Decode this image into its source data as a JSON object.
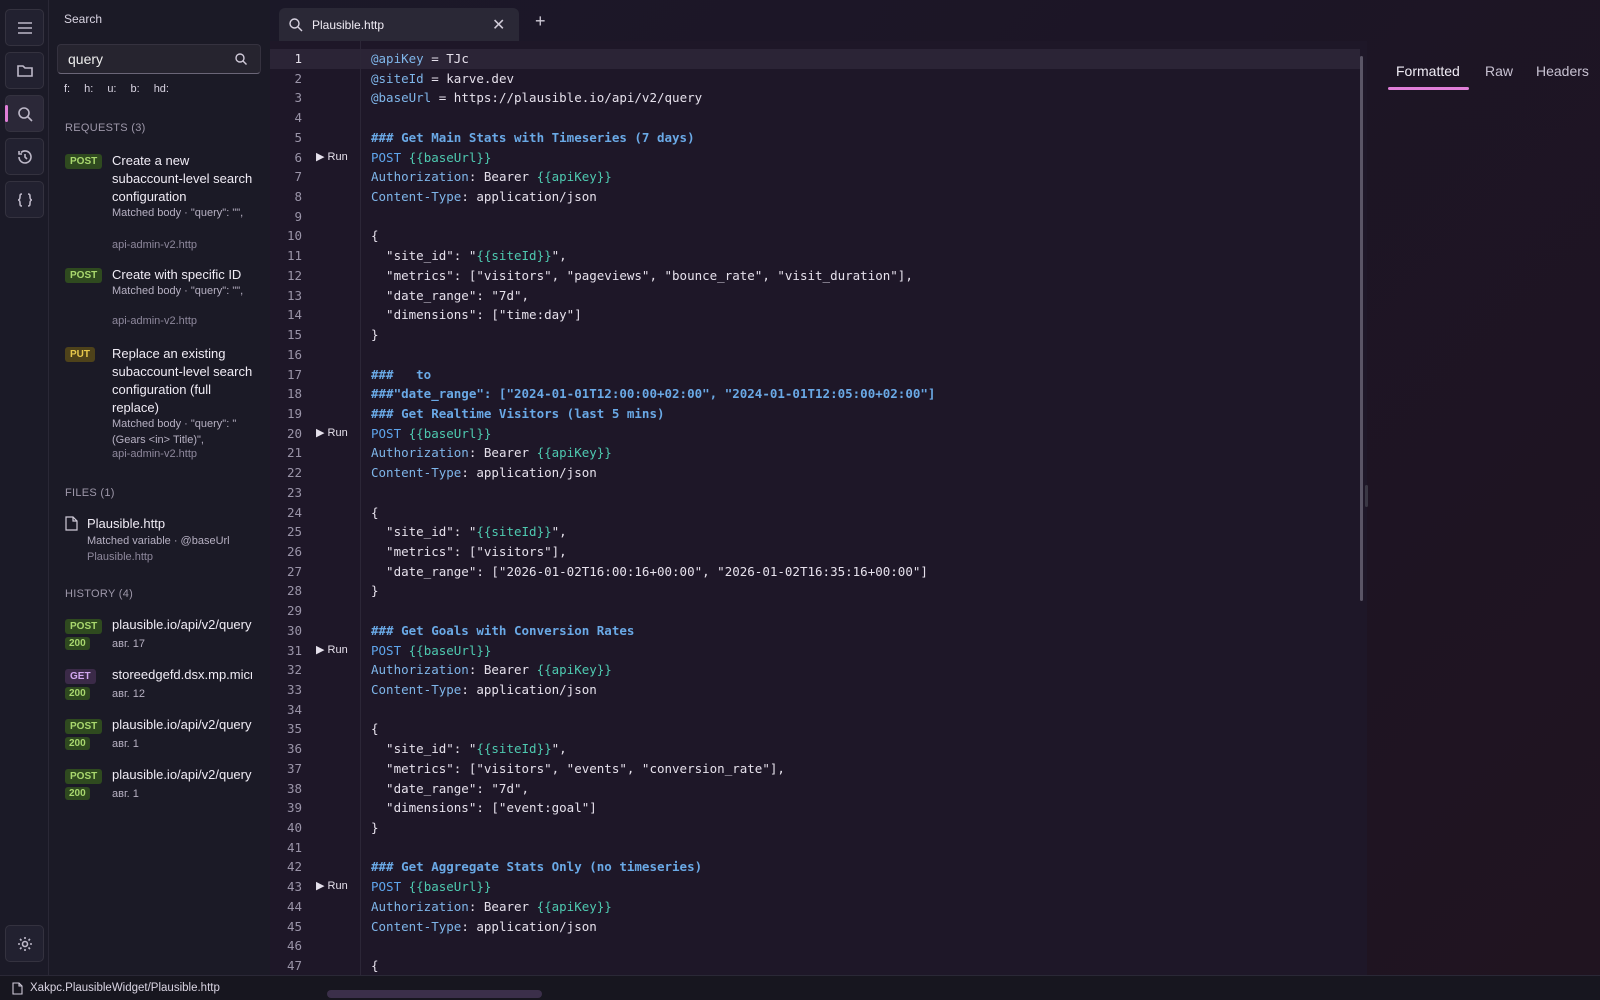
{
  "activity": {
    "items": [
      "menu-icon",
      "folder-icon",
      "search-icon",
      "history-icon",
      "braces-icon",
      "settings-icon"
    ],
    "accent": "#e07ed8"
  },
  "search": {
    "title": "Search",
    "query": "query",
    "filters": [
      "f:",
      "h:",
      "u:",
      "b:",
      "hd:"
    ]
  },
  "requests": {
    "header": "REQUESTS (3)",
    "items": [
      {
        "method": "POST",
        "title": "Create a new subaccount-level search configuration",
        "match": "Matched body · \"query\": \"\",",
        "file": "api-admin-v2.http"
      },
      {
        "method": "POST",
        "title": "Create with specific ID",
        "match": "Matched body · \"query\": \"\",",
        "file": "api-admin-v2.http"
      },
      {
        "method": "PUT",
        "title": "Replace an existing subaccount-level search configuration (full replace)",
        "match": "Matched body · \"query\": \"(Gears <in> Title)\",",
        "file": "api-admin-v2.http"
      }
    ]
  },
  "files": {
    "header": "FILES (1)",
    "items": [
      {
        "name": "Plausible.http",
        "match": "Matched variable · @baseUrl",
        "path": "Plausible.http"
      }
    ]
  },
  "history": {
    "header": "HISTORY (4)",
    "items": [
      {
        "method": "POST",
        "url": "plausible.io/api/v2/query",
        "status": "200",
        "date": "авг. 17"
      },
      {
        "method": "GET",
        "url": "storeedgefd.dsx.mp.microsoft.com",
        "status": "200",
        "date": "авг. 12"
      },
      {
        "method": "POST",
        "url": "plausible.io/api/v2/query",
        "status": "200",
        "date": "авг. 1"
      },
      {
        "method": "POST",
        "url": "plausible.io/api/v2/query",
        "status": "200",
        "date": "авг. 1"
      }
    ]
  },
  "tab": {
    "label": "Plausible.http",
    "close": "✕",
    "add": "+"
  },
  "editor": {
    "run_label": "▶ Run",
    "lines": [
      "@apiKey = TJc",
      "@siteId = karve.dev",
      "@baseUrl = https://plausible.io/api/v2/query",
      "",
      "### Get Main Stats with Timeseries (7 days)",
      "POST {{baseUrl}}",
      "Authorization: Bearer {{apiKey}}",
      "Content-Type: application/json",
      "",
      "{",
      "  \"site_id\": \"{{siteId}}\",",
      "  \"metrics\": [\"visitors\", \"pageviews\", \"bounce_rate\", \"visit_duration\"],",
      "  \"date_range\": \"7d\",",
      "  \"dimensions\": [\"time:day\"]",
      "}",
      "",
      "###   to",
      "###\"date_range\": [\"2024-01-01T12:00:00+02:00\", \"2024-01-01T12:05:00+02:00\"]",
      "### Get Realtime Visitors (last 5 mins)",
      "POST {{baseUrl}}",
      "Authorization: Bearer {{apiKey}}",
      "Content-Type: application/json",
      "",
      "{",
      "  \"site_id\": \"{{siteId}}\",",
      "  \"metrics\": [\"visitors\"],",
      "  \"date_range\": [\"2026-01-02T16:00:16+00:00\", \"2026-01-02T16:35:16+00:00\"]",
      "}",
      "",
      "### Get Goals with Conversion Rates",
      "POST {{baseUrl}}",
      "Authorization: Bearer {{apiKey}}",
      "Content-Type: application/json",
      "",
      "{",
      "  \"site_id\": \"{{siteId}}\",",
      "  \"metrics\": [\"visitors\", \"events\", \"conversion_rate\"],",
      "  \"date_range\": \"7d\",",
      "  \"dimensions\": [\"event:goal\"]",
      "}",
      "",
      "### Get Aggregate Stats Only (no timeseries)",
      "POST {{baseUrl}}",
      "Authorization: Bearer {{apiKey}}",
      "Content-Type: application/json",
      "",
      "{"
    ],
    "run_lines": [
      6,
      20,
      31,
      43
    ],
    "current_line": 1
  },
  "response": {
    "tabs": [
      "Formatted",
      "Raw",
      "Headers"
    ],
    "active": "Formatted"
  },
  "statusbar": {
    "path": "Xakpc.PlausibleWidget/Plausible.http"
  }
}
